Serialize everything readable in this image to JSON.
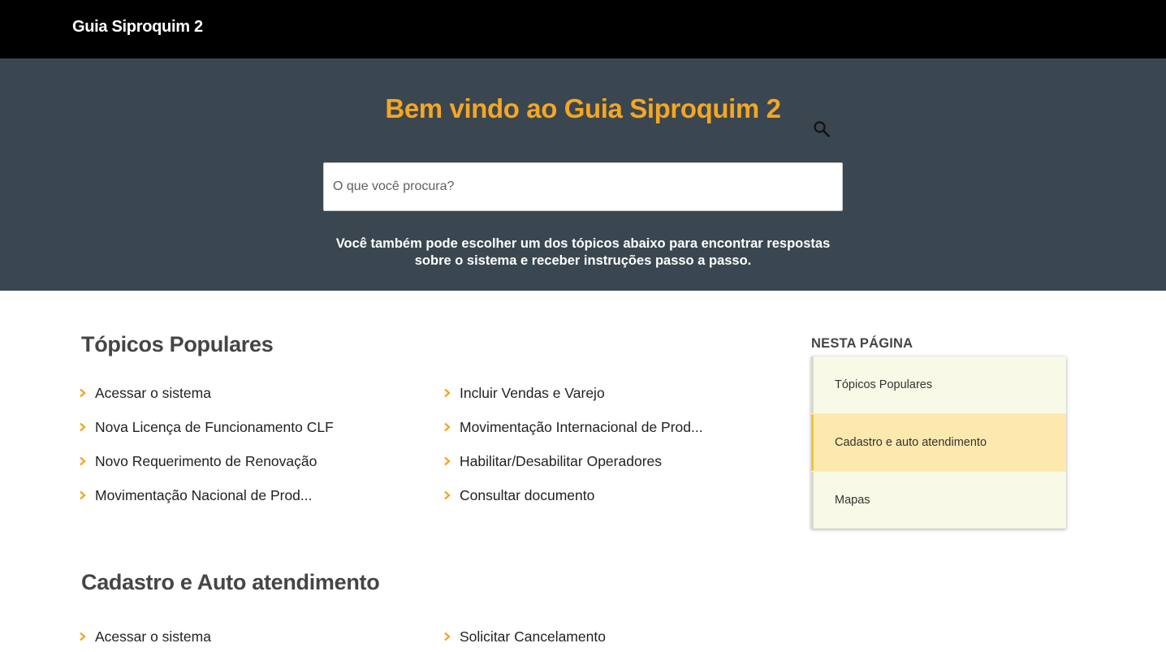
{
  "header": {
    "brand": "Guia Siproquim 2"
  },
  "hero": {
    "title": "Bem vindo ao Guia Siproquim 2",
    "search_placeholder": "O que você procura?",
    "description_line1": "Você também pode escolher um dos tópicos abaixo para encontrar respostas",
    "description_line2": "sobre o sistema e receber instruções passo a passo."
  },
  "sections": [
    {
      "title": "Tópicos Populares",
      "topics_left": [
        "Acessar o sistema",
        "Nova Licença de Funcionamento CLF",
        "Novo Requerimento de Renovação",
        "Movimentação Nacional de Prod..."
      ],
      "topics_right": [
        "Incluir Vendas e Varejo",
        "Movimentação Internacional de Prod...",
        "Habilitar/Desabilitar Operadores",
        "Consultar documento"
      ]
    },
    {
      "title": "Cadastro e Auto atendimento",
      "topics_left": [
        "Acessar o sistema"
      ],
      "topics_right": [
        "Solicitar Cancelamento"
      ]
    }
  ],
  "toc": {
    "title": "NESTA PÁGINA",
    "items": [
      "Tópicos Populares",
      "Cadastro e auto atendimento",
      "Mapas"
    ],
    "active_index": 1
  },
  "colors": {
    "accent": "#f5a623",
    "header_bg": "#000000",
    "hero_bg": "#3a4750",
    "toc_bg": "#f8f9e6",
    "toc_active_bg": "#fde9ad"
  },
  "icons": {
    "search": "search-icon",
    "bullet": "chevron-right-icon"
  }
}
